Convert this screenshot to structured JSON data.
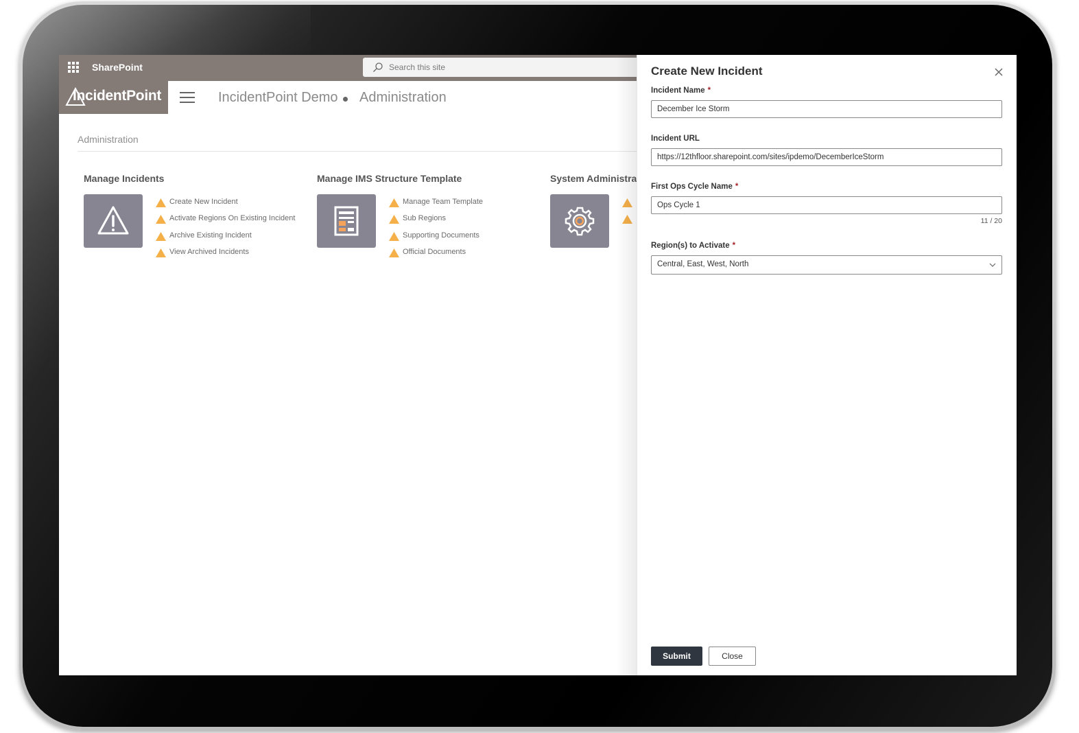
{
  "suitebar": {
    "app_name": "SharePoint",
    "search_placeholder": "Search this site"
  },
  "site_header": {
    "logo_text": "IncidentPoint",
    "site_name": "IncidentPoint Demo",
    "current_page": "Administration"
  },
  "page": {
    "title": "Administration",
    "sections": [
      {
        "title": "Manage Incidents",
        "icon": "warning-icon",
        "links": [
          "Create New Incident",
          "Activate Regions On Existing Incident",
          "Archive Existing Incident",
          "View Archived Incidents"
        ]
      },
      {
        "title": "Manage IMS Structure Template",
        "icon": "template-icon",
        "links": [
          "Manage Team Template",
          "Sub Regions",
          "Supporting Documents",
          "Official Documents"
        ]
      },
      {
        "title": "System Administra",
        "icon": "gear-icon",
        "links": [
          "",
          ""
        ]
      }
    ]
  },
  "panel": {
    "title": "Create New Incident",
    "incident_name": {
      "label": "Incident Name",
      "value": "December Ice Storm"
    },
    "incident_url": {
      "label": "Incident URL",
      "value": "https://12thfloor.sharepoint.com/sites/ipdemo/DecemberIceStorm"
    },
    "ops_cycle": {
      "label": "First Ops Cycle Name",
      "value": "Ops Cycle 1",
      "counter": "11 / 20"
    },
    "regions": {
      "label": "Region(s) to Activate",
      "value": "Central, East, West, North"
    },
    "required_mark": "*",
    "submit_label": "Submit",
    "close_label": "Close"
  },
  "colors": {
    "suitebar_bg": "#847b77",
    "tile_bg": "#868591",
    "accent_orange": "#f5b04a",
    "submit_bg": "#2f3640",
    "required_red": "#a4262c"
  }
}
